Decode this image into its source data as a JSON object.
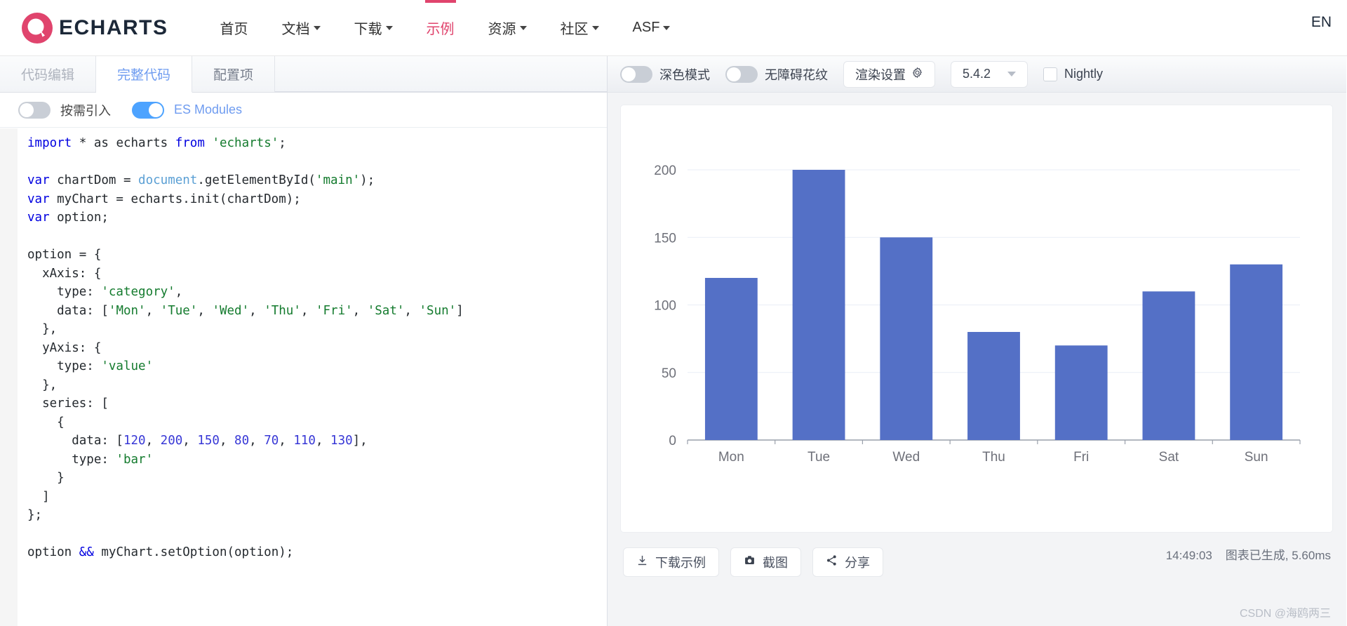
{
  "nav": {
    "logo_text": "ECHARTS",
    "logo_icon": "echarts-logo-icon",
    "items": [
      {
        "label": "首页",
        "caret": false,
        "active": false
      },
      {
        "label": "文档",
        "caret": true,
        "active": false
      },
      {
        "label": "下载",
        "caret": true,
        "active": false
      },
      {
        "label": "示例",
        "caret": false,
        "active": true
      },
      {
        "label": "资源",
        "caret": true,
        "active": false
      },
      {
        "label": "社区",
        "caret": true,
        "active": false
      },
      {
        "label": "ASF",
        "caret": true,
        "active": false
      }
    ],
    "lang_label": "EN",
    "accent_color": "#e0446d"
  },
  "editor": {
    "tabs": [
      {
        "label": "代码编辑",
        "state": "gray"
      },
      {
        "label": "完整代码",
        "state": "active"
      },
      {
        "label": "配置项",
        "state": "normal"
      }
    ],
    "toggles": [
      {
        "label": "按需引入",
        "on": false,
        "label_color": "#444444"
      },
      {
        "label": "ES Modules",
        "on": true,
        "label_color": "#6f9cf0"
      }
    ],
    "code_lines": [
      [
        {
          "t": "import",
          "c": "kw"
        },
        {
          "t": " * ",
          "c": "pl"
        },
        {
          "t": "as",
          "c": "pl"
        },
        {
          "t": " echarts ",
          "c": "pl"
        },
        {
          "t": "from",
          "c": "kw"
        },
        {
          "t": " ",
          "c": "pl"
        },
        {
          "t": "'echarts'",
          "c": "str"
        },
        {
          "t": ";",
          "c": "pl"
        }
      ],
      [],
      [
        {
          "t": "var",
          "c": "kw"
        },
        {
          "t": " chartDom = ",
          "c": "pl"
        },
        {
          "t": "document",
          "c": "obj"
        },
        {
          "t": ".getElementById(",
          "c": "pl"
        },
        {
          "t": "'main'",
          "c": "str"
        },
        {
          "t": ");",
          "c": "pl"
        }
      ],
      [
        {
          "t": "var",
          "c": "kw"
        },
        {
          "t": " myChart = echarts.init(chartDom);",
          "c": "pl"
        }
      ],
      [
        {
          "t": "var",
          "c": "kw"
        },
        {
          "t": " option;",
          "c": "pl"
        }
      ],
      [],
      [
        {
          "t": "option = {",
          "c": "pl"
        }
      ],
      [
        {
          "t": "  xAxis: {",
          "c": "pl"
        }
      ],
      [
        {
          "t": "    type: ",
          "c": "pl"
        },
        {
          "t": "'category'",
          "c": "str"
        },
        {
          "t": ",",
          "c": "pl"
        }
      ],
      [
        {
          "t": "    data: [",
          "c": "pl"
        },
        {
          "t": "'Mon'",
          "c": "str"
        },
        {
          "t": ", ",
          "c": "pl"
        },
        {
          "t": "'Tue'",
          "c": "str"
        },
        {
          "t": ", ",
          "c": "pl"
        },
        {
          "t": "'Wed'",
          "c": "str"
        },
        {
          "t": ", ",
          "c": "pl"
        },
        {
          "t": "'Thu'",
          "c": "str"
        },
        {
          "t": ", ",
          "c": "pl"
        },
        {
          "t": "'Fri'",
          "c": "str"
        },
        {
          "t": ", ",
          "c": "pl"
        },
        {
          "t": "'Sat'",
          "c": "str"
        },
        {
          "t": ", ",
          "c": "pl"
        },
        {
          "t": "'Sun'",
          "c": "str"
        },
        {
          "t": "]",
          "c": "pl"
        }
      ],
      [
        {
          "t": "  },",
          "c": "pl"
        }
      ],
      [
        {
          "t": "  yAxis: {",
          "c": "pl"
        }
      ],
      [
        {
          "t": "    type: ",
          "c": "pl"
        },
        {
          "t": "'value'",
          "c": "str"
        }
      ],
      [
        {
          "t": "  },",
          "c": "pl"
        }
      ],
      [
        {
          "t": "  series: [",
          "c": "pl"
        }
      ],
      [
        {
          "t": "    {",
          "c": "pl"
        }
      ],
      [
        {
          "t": "      data: [",
          "c": "pl"
        },
        {
          "t": "120",
          "c": "num"
        },
        {
          "t": ", ",
          "c": "pl"
        },
        {
          "t": "200",
          "c": "num"
        },
        {
          "t": ", ",
          "c": "pl"
        },
        {
          "t": "150",
          "c": "num"
        },
        {
          "t": ", ",
          "c": "pl"
        },
        {
          "t": "80",
          "c": "num"
        },
        {
          "t": ", ",
          "c": "pl"
        },
        {
          "t": "70",
          "c": "num"
        },
        {
          "t": ", ",
          "c": "pl"
        },
        {
          "t": "110",
          "c": "num"
        },
        {
          "t": ", ",
          "c": "pl"
        },
        {
          "t": "130",
          "c": "num"
        },
        {
          "t": "],",
          "c": "pl"
        }
      ],
      [
        {
          "t": "      type: ",
          "c": "pl"
        },
        {
          "t": "'bar'",
          "c": "str"
        }
      ],
      [
        {
          "t": "    }",
          "c": "pl"
        }
      ],
      [
        {
          "t": "  ]",
          "c": "pl"
        }
      ],
      [
        {
          "t": "};",
          "c": "pl"
        }
      ],
      [],
      [
        {
          "t": "option ",
          "c": "pl"
        },
        {
          "t": "&&",
          "c": "kw"
        },
        {
          "t": " myChart.setOption(option);",
          "c": "pl"
        }
      ]
    ]
  },
  "preview": {
    "toggles": [
      {
        "label": "深色模式",
        "on": false
      },
      {
        "label": "无障碍花纹",
        "on": false
      }
    ],
    "render_settings_label": "渲染设置",
    "render_settings_icon": "gear-icon",
    "version": "5.4.2",
    "version_chevron_icon": "chevron-down-icon",
    "nightly_label": "Nightly",
    "nightly_checked": false,
    "buttons": [
      {
        "label": "下载示例",
        "icon": "download-icon"
      },
      {
        "label": "截图",
        "icon": "camera-icon"
      },
      {
        "label": "分享",
        "icon": "share-icon"
      }
    ],
    "status_time": "14:49:03",
    "status_text": "图表已生成, 5.60ms",
    "watermark": "CSDN @海鸥两三"
  },
  "chart_data": {
    "type": "bar",
    "title": "",
    "subtitle": "",
    "xlabel": "",
    "ylabel": "",
    "categories": [
      "Mon",
      "Tue",
      "Wed",
      "Thu",
      "Fri",
      "Sat",
      "Sun"
    ],
    "values": [
      120,
      200,
      150,
      80,
      70,
      110,
      130
    ],
    "ylim": [
      0,
      200
    ],
    "yticks": [
      0,
      50,
      100,
      150,
      200
    ],
    "grid": true,
    "legend": "none",
    "bar_color": "#5470c6",
    "axis_line_color": "#6e7079",
    "grid_line_color": "#e9edf7",
    "label_color": "#6e7079"
  }
}
